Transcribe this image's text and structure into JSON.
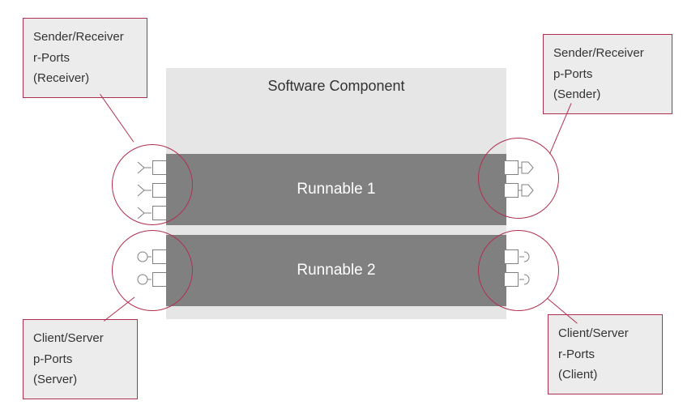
{
  "component": {
    "title": "Software Component",
    "runnables": [
      {
        "label": "Runnable 1"
      },
      {
        "label": "Runnable 2"
      }
    ]
  },
  "callouts": {
    "top_left": {
      "line1": "Sender/Receiver",
      "line2": "r-Ports",
      "line3": "(Receiver)"
    },
    "bottom_left": {
      "line1": "Client/Server",
      "line2": "p-Ports",
      "line3": "(Server)"
    },
    "top_right": {
      "line1": "Sender/Receiver",
      "line2": "p-Ports",
      "line3": "(Sender)"
    },
    "bottom_right": {
      "line1": "Client/Server",
      "line2": "r-Ports",
      "line3": "(Client)"
    }
  },
  "colors": {
    "accent": "#b03050",
    "component_bg": "#e6e6e6",
    "runnable_bg": "#808080"
  }
}
